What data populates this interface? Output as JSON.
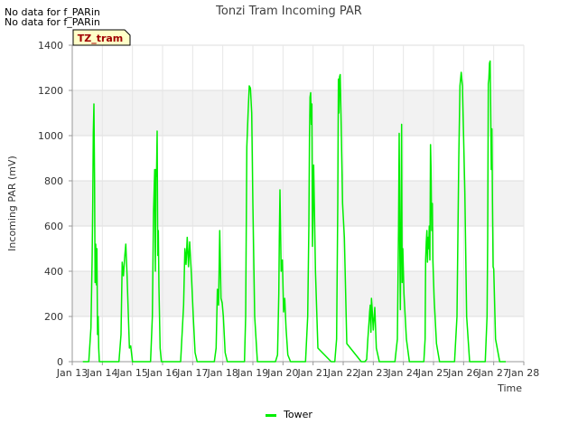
{
  "notices": [
    "No data for f_PARin",
    "No data for f_PARin"
  ],
  "site_badge": "TZ_tram",
  "chart_data": {
    "type": "line",
    "title": "Tonzi Tram Incoming PAR",
    "xlabel": "Time",
    "ylabel": "Incoming PAR (mV)",
    "ylim": [
      0,
      1400
    ],
    "xlim": [
      13,
      28
    ],
    "x_ticks": [
      13,
      14,
      15,
      16,
      17,
      18,
      19,
      20,
      21,
      22,
      23,
      24,
      25,
      26,
      27,
      28
    ],
    "x_tick_labels": [
      "Jan 13",
      "Jan 14",
      "Jan 15",
      "Jan 16",
      "Jan 17",
      "Jan 18",
      "Jan 19",
      "Jan 20",
      "Jan 21",
      "Jan 22",
      "Jan 23",
      "Jan 24",
      "Jan 25",
      "Jan 26",
      "Jan 27",
      "Jan 28"
    ],
    "y_ticks": [
      0,
      200,
      400,
      600,
      800,
      1000,
      1200,
      1400
    ],
    "grid": true,
    "legend_position": "bottom-center",
    "series": [
      {
        "name": "Tower",
        "color": "#00ee00",
        "x": [
          13.35,
          13.55,
          13.62,
          13.66,
          13.68,
          13.7,
          13.72,
          13.74,
          13.76,
          13.78,
          13.8,
          13.82,
          13.84,
          13.86,
          13.88,
          13.9,
          14.0,
          14.3,
          14.55,
          14.62,
          14.66,
          14.7,
          14.74,
          14.78,
          14.82,
          14.86,
          14.9,
          14.94,
          15.0,
          15.4,
          15.6,
          15.66,
          15.7,
          15.74,
          15.76,
          15.78,
          15.8,
          15.82,
          15.84,
          15.86,
          15.88,
          15.92,
          15.96,
          16.05,
          16.45,
          16.6,
          16.7,
          16.74,
          16.78,
          16.82,
          16.86,
          16.9,
          16.96,
          17.02,
          17.08,
          17.15,
          17.6,
          17.72,
          17.78,
          17.82,
          17.86,
          17.9,
          17.94,
          17.98,
          18.02,
          18.08,
          18.15,
          18.6,
          18.72,
          18.76,
          18.8,
          18.84,
          18.88,
          18.92,
          18.96,
          19.0,
          19.06,
          19.15,
          19.6,
          19.75,
          19.82,
          19.86,
          19.88,
          19.9,
          19.94,
          19.98,
          20.02,
          20.06,
          20.1,
          20.16,
          20.25,
          20.6,
          20.75,
          20.82,
          20.86,
          20.88,
          20.9,
          20.92,
          20.94,
          20.96,
          20.98,
          21.02,
          21.08,
          21.16,
          21.6,
          21.72,
          21.78,
          21.82,
          21.84,
          21.86,
          21.88,
          21.9,
          21.94,
          21.98,
          22.04,
          22.12,
          22.6,
          22.72,
          22.78,
          22.82,
          22.86,
          22.88,
          22.9,
          22.92,
          22.94,
          22.96,
          23.0,
          23.05,
          23.1,
          23.2,
          23.6,
          23.72,
          23.8,
          23.84,
          23.86,
          23.88,
          23.9,
          23.92,
          23.94,
          23.96,
          23.98,
          24.02,
          24.1,
          24.2,
          24.6,
          24.68,
          24.72,
          24.74,
          24.76,
          24.78,
          24.8,
          24.82,
          24.84,
          24.86,
          24.88,
          24.9,
          24.92,
          24.94,
          24.96,
          24.98,
          25.02,
          25.1,
          25.2,
          25.6,
          25.7,
          25.78,
          25.84,
          25.88,
          25.92,
          25.96,
          26.0,
          26.04,
          26.1,
          26.2,
          26.6,
          26.72,
          26.78,
          26.8,
          26.82,
          26.84,
          26.86,
          26.88,
          26.9,
          26.92,
          26.94,
          26.96,
          26.98,
          27.0,
          27.06,
          27.2,
          27.4
        ],
        "values": [
          0,
          0,
          150,
          450,
          700,
          1010,
          1140,
          800,
          350,
          520,
          340,
          500,
          120,
          200,
          60,
          0,
          0,
          0,
          0,
          120,
          440,
          380,
          460,
          520,
          380,
          220,
          60,
          70,
          0,
          0,
          0,
          200,
          660,
          850,
          400,
          850,
          820,
          1020,
          470,
          580,
          330,
          60,
          0,
          0,
          0,
          0,
          250,
          500,
          430,
          550,
          420,
          530,
          380,
          200,
          40,
          0,
          0,
          0,
          60,
          320,
          250,
          580,
          280,
          260,
          200,
          40,
          0,
          0,
          0,
          200,
          950,
          1100,
          1220,
          1210,
          1100,
          700,
          200,
          0,
          0,
          0,
          30,
          300,
          550,
          760,
          400,
          450,
          220,
          280,
          150,
          30,
          0,
          0,
          0,
          200,
          600,
          1000,
          1170,
          1190,
          1050,
          1140,
          510,
          870,
          400,
          60,
          0,
          0,
          100,
          700,
          1250,
          1100,
          1260,
          1270,
          1000,
          700,
          550,
          80,
          0,
          0,
          10,
          100,
          180,
          220,
          250,
          130,
          280,
          240,
          140,
          240,
          60,
          0,
          0,
          0,
          100,
          600,
          1010,
          500,
          230,
          580,
          1050,
          350,
          500,
          300,
          100,
          0,
          0,
          0,
          100,
          450,
          530,
          580,
          440,
          550,
          500,
          600,
          450,
          960,
          850,
          580,
          700,
          450,
          280,
          80,
          0,
          0,
          0,
          200,
          900,
          1220,
          1280,
          1220,
          1000,
          750,
          200,
          0,
          0,
          0,
          200,
          550,
          1230,
          1250,
          1320,
          1330,
          1130,
          850,
          1030,
          700,
          420,
          410,
          100,
          0,
          0
        ]
      }
    ]
  }
}
